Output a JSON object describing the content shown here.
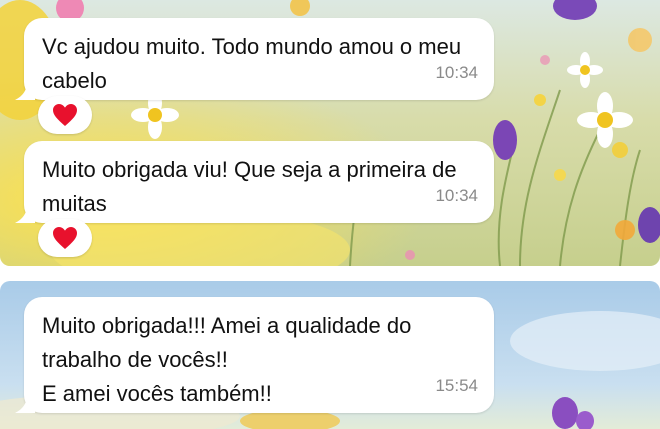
{
  "messages": [
    {
      "text": "Vc ajudou muito. Todo mundo amou o meu cabelo",
      "time": "10:34",
      "reaction": "heart-icon"
    },
    {
      "text": "Muito obrigada viu! Que seja a primeira de muitas",
      "time": "10:34",
      "reaction": "heart-icon"
    },
    {
      "text": "Muito obrigada!!! Amei a qualidade do trabalho de vocês!!\nE amei vocês também!!",
      "time": "15:54"
    }
  ],
  "colors": {
    "bubble": "#ffffff",
    "text": "#111111",
    "timestamp": "#8a8a8a",
    "heart": "#e8112d",
    "sky": "#bcd8ee",
    "meadow": "#cfd59a"
  }
}
